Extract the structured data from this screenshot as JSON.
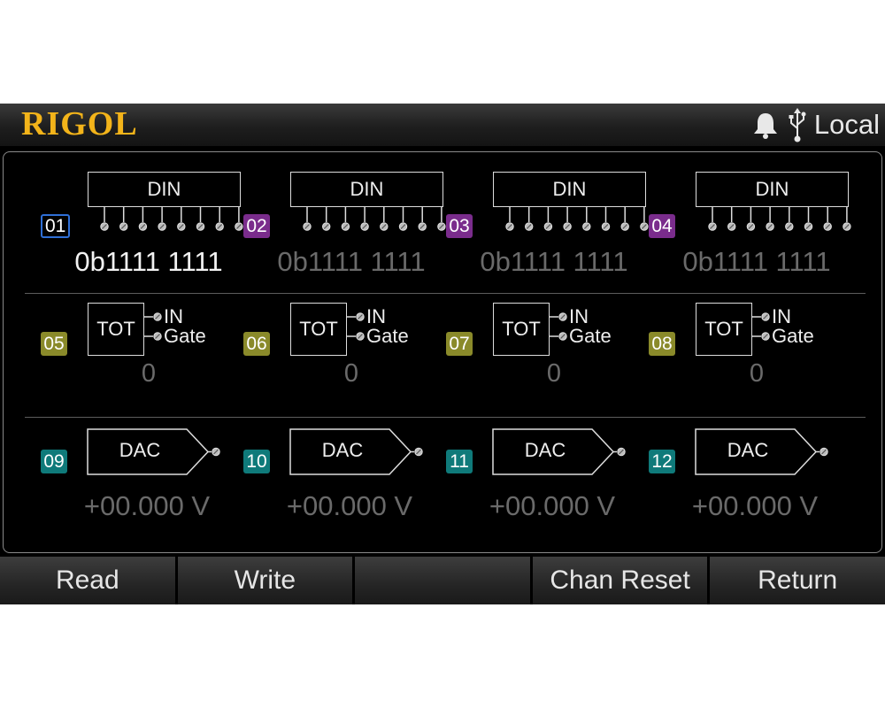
{
  "header": {
    "logo": "RIGOL",
    "status_text": "Local",
    "icons": [
      "bell-icon",
      "usb-icon"
    ]
  },
  "din": [
    {
      "channel": "01",
      "label": "DIN",
      "value": "0b1111 1111",
      "selected": true
    },
    {
      "channel": "02",
      "label": "DIN",
      "value": "0b1111 1111",
      "selected": false
    },
    {
      "channel": "03",
      "label": "DIN",
      "value": "0b1111 1111",
      "selected": false
    },
    {
      "channel": "04",
      "label": "DIN",
      "value": "0b1111 1111",
      "selected": false
    }
  ],
  "tot": [
    {
      "channel": "05",
      "label": "TOT",
      "in_label": "IN",
      "gate_label": "Gate",
      "value": "0"
    },
    {
      "channel": "06",
      "label": "TOT",
      "in_label": "IN",
      "gate_label": "Gate",
      "value": "0"
    },
    {
      "channel": "07",
      "label": "TOT",
      "in_label": "IN",
      "gate_label": "Gate",
      "value": "0"
    },
    {
      "channel": "08",
      "label": "TOT",
      "in_label": "IN",
      "gate_label": "Gate",
      "value": "0"
    }
  ],
  "dac": [
    {
      "channel": "09",
      "label": "DAC",
      "value": "+00.000 V"
    },
    {
      "channel": "10",
      "label": "DAC",
      "value": "+00.000 V"
    },
    {
      "channel": "11",
      "label": "DAC",
      "value": "+00.000 V"
    },
    {
      "channel": "12",
      "label": "DAC",
      "value": "+00.000 V"
    }
  ],
  "softkeys": [
    "Read",
    "Write",
    "",
    "Chan Reset",
    "Return"
  ],
  "colors": {
    "logo": "#f3b41a",
    "din_badge": "#7a2c8c",
    "tot_badge": "#8a8a2a",
    "dac_badge": "#0f7a7a",
    "selected_border": "#2f6fd6"
  }
}
